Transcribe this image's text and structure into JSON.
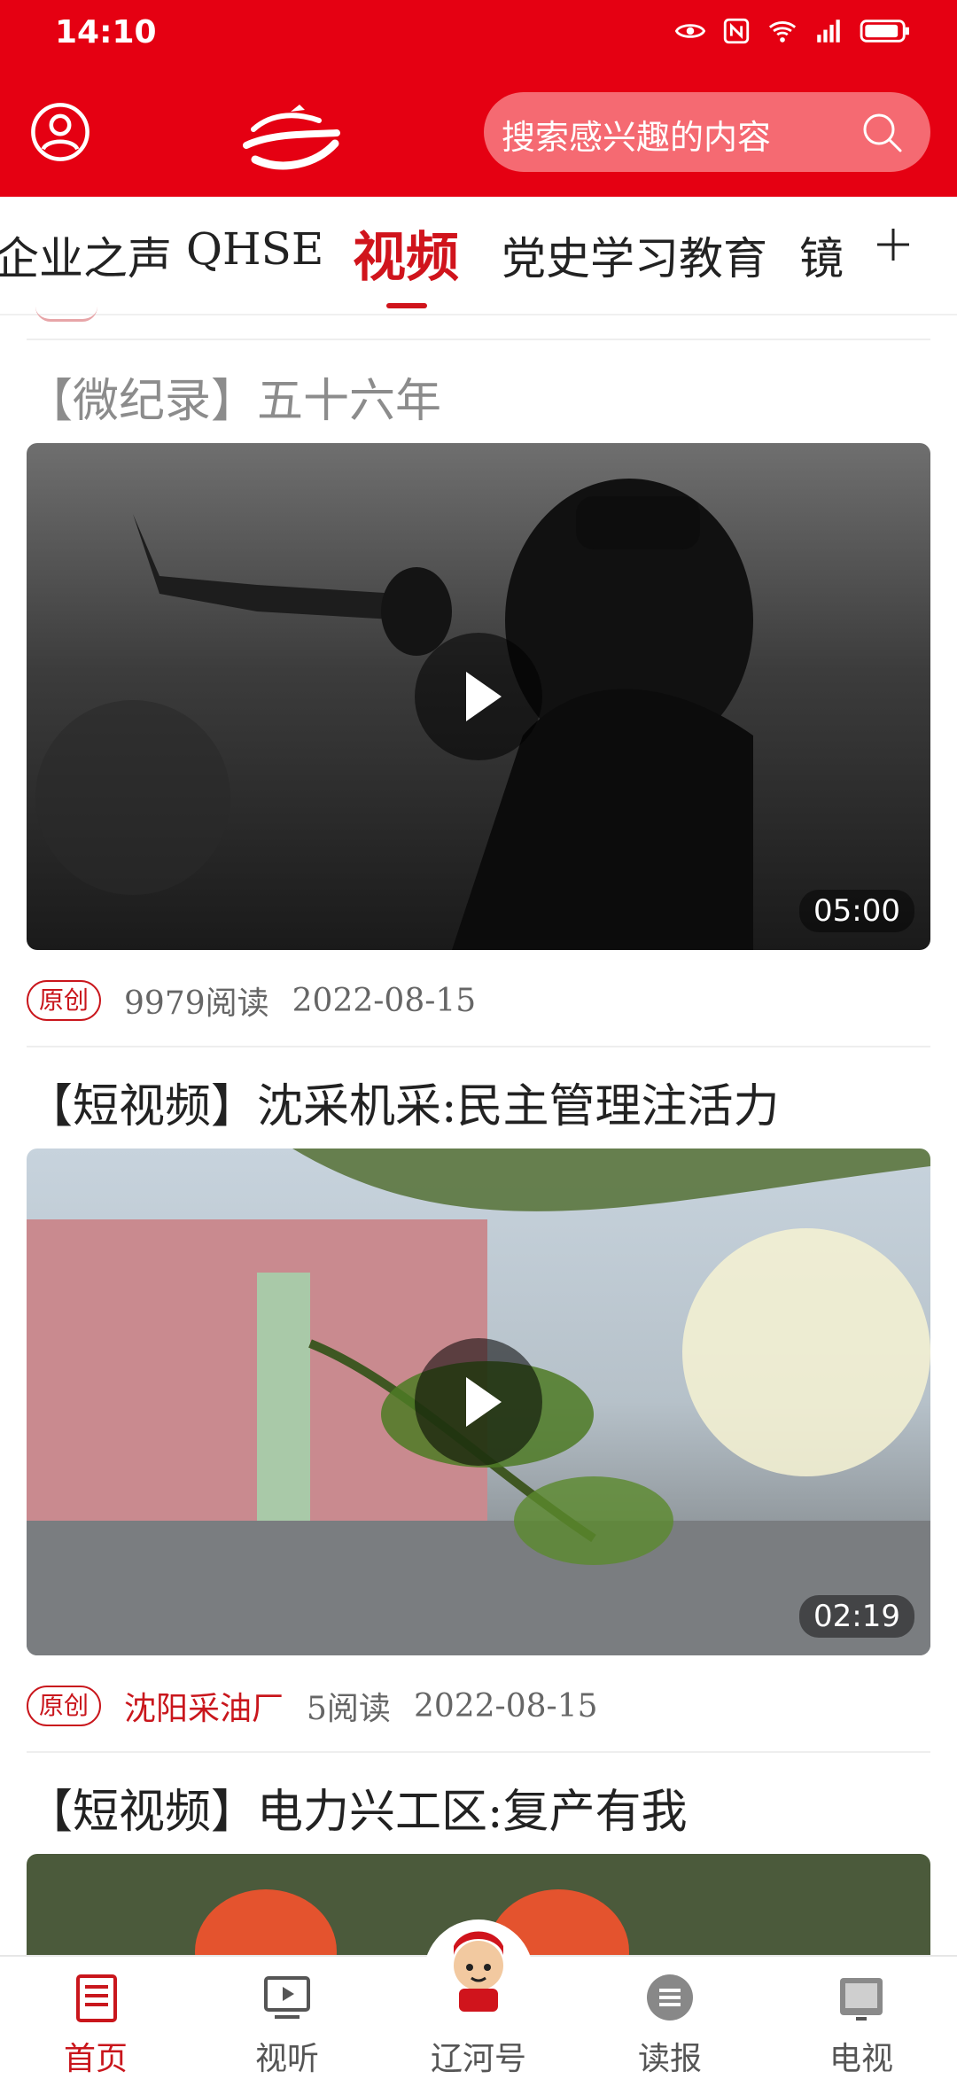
{
  "status_bar": {
    "time": "14:10"
  },
  "search": {
    "placeholder": "搜索感兴趣的内容"
  },
  "tabs": [
    "企业之声",
    "QHSE",
    "视频",
    "党史学习教育",
    "镜"
  ],
  "feed": [
    {
      "title": "【微纪录】五十六年",
      "duration": "05:00",
      "badge": "原创",
      "reads": "9979阅读",
      "date": "2022-08-15"
    },
    {
      "title": "【短视频】沈采机采:民主管理注活力",
      "duration": "02:19",
      "badge": "原创",
      "source": "沈阳采油厂",
      "reads": "5阅读",
      "date": "2022-08-15"
    },
    {
      "title": "【短视频】电力兴工区:复产有我"
    }
  ],
  "bottom_nav": [
    "首页",
    "视听",
    "辽河号",
    "读报",
    "电视"
  ],
  "colors": {
    "brand_red": "#e50012",
    "accent_red": "#c9161c"
  }
}
